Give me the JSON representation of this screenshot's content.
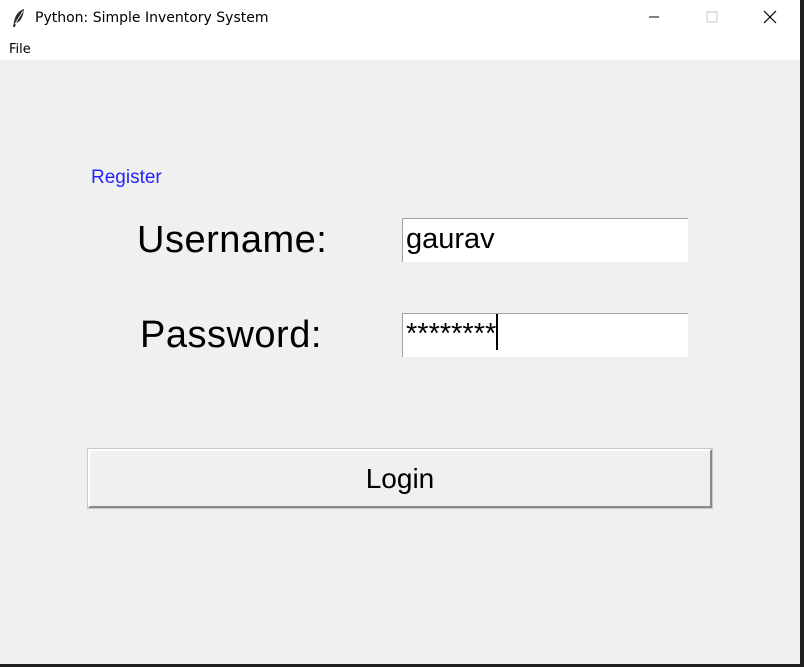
{
  "window": {
    "title": "Python: Simple Inventory System",
    "icon": "feather-icon"
  },
  "menubar": {
    "items": [
      "File"
    ]
  },
  "form": {
    "register_link": "Register",
    "username_label": "Username:",
    "username_value": "gaurav",
    "password_label": "Password:",
    "password_value": "********",
    "login_label": "Login"
  },
  "colors": {
    "link": "#2323ff",
    "background": "#f0f0f0"
  }
}
